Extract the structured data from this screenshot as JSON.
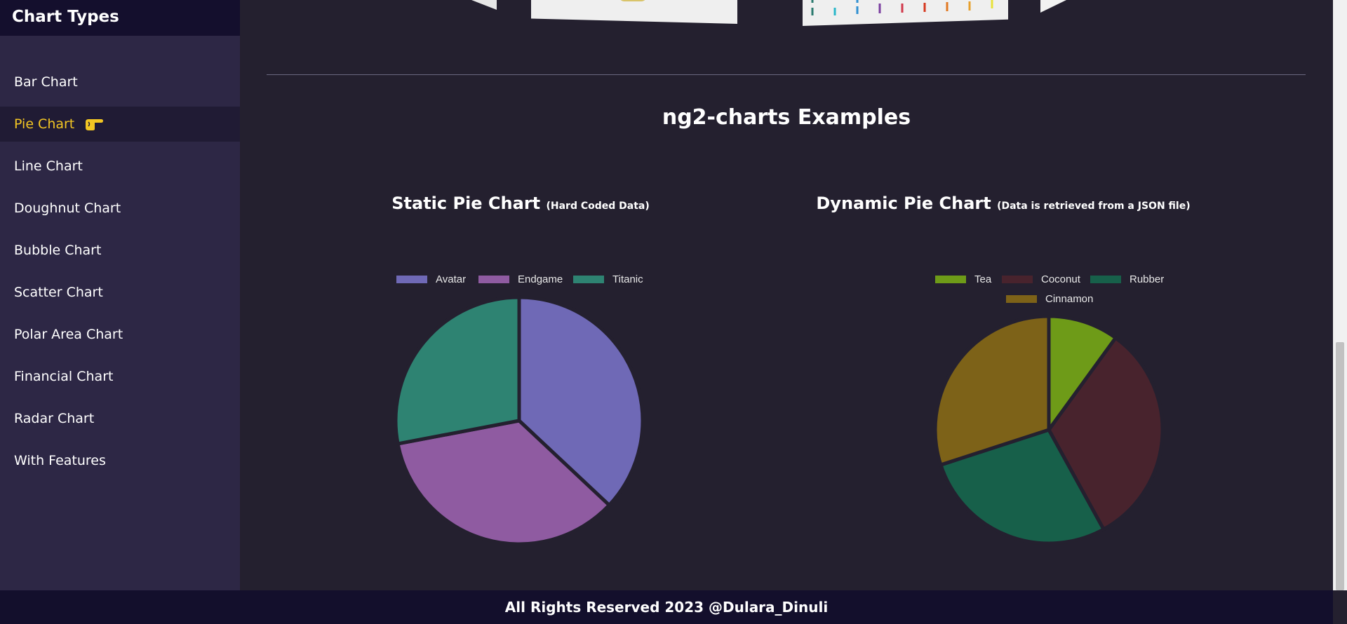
{
  "sidebar": {
    "title": "Chart Types",
    "items": [
      {
        "label": "Bar Chart",
        "active": false
      },
      {
        "label": "Pie Chart",
        "active": true
      },
      {
        "label": "Line Chart",
        "active": false
      },
      {
        "label": "Doughnut Chart",
        "active": false
      },
      {
        "label": "Bubble Chart",
        "active": false
      },
      {
        "label": "Scatter Chart",
        "active": false
      },
      {
        "label": "Polar Area Chart",
        "active": false
      },
      {
        "label": "Financial Chart",
        "active": false
      },
      {
        "label": "Radar Chart",
        "active": false
      },
      {
        "label": "With Features",
        "active": false
      }
    ]
  },
  "main": {
    "heading": "ng2-charts Examples"
  },
  "colors": {
    "accent": "#f3c623",
    "background": "#24202f",
    "sidebar": "#2d2745",
    "header": "#140f2d"
  },
  "chart_data": [
    {
      "type": "pie",
      "title": "Static Pie Chart",
      "subtitle": "(Hard Coded Data)",
      "categories": [
        "Avatar",
        "Endgame",
        "Titanic"
      ],
      "values": [
        37,
        35,
        28
      ],
      "colors": [
        "#6f69b6",
        "#8f5ba1",
        "#2e8372"
      ]
    },
    {
      "type": "pie",
      "title": "Dynamic Pie Chart",
      "subtitle": "(Data is retrieved from a JSON file)",
      "categories": [
        "Tea",
        "Coconut",
        "Rubber",
        "Cinnamon"
      ],
      "values": [
        10,
        32,
        28,
        30
      ],
      "colors": [
        "#6e9b18",
        "#48232d",
        "#17604a",
        "#7d6218"
      ]
    }
  ],
  "footer": {
    "text": "All Rights Reserved 2023 @Dulara_Dinuli"
  }
}
